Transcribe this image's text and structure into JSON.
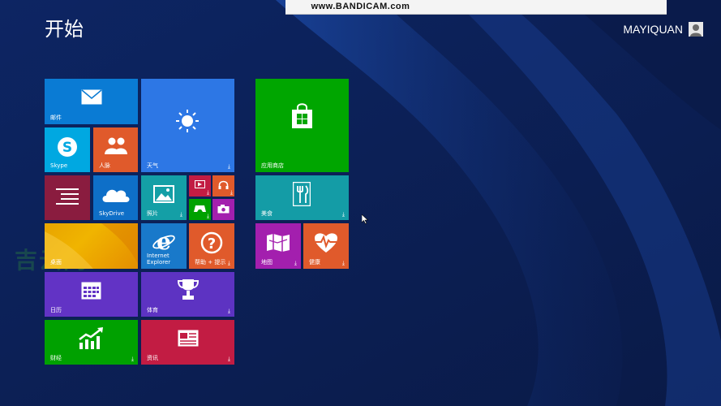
{
  "watermark": "www.BANDICAM.com",
  "start": {
    "title": "开始"
  },
  "user": {
    "name": "MAYIQUAN",
    "icon": "user-avatar-icon"
  },
  "side_logo": "吉云网",
  "colors": {
    "background": "#0b1d4f",
    "mail": "#0a7bd4",
    "weather": "#2d77e5",
    "store": "#00a600",
    "skype": "#00a8e1",
    "people": "#e05a2b",
    "reading": "#8a1c3f",
    "skydrive": "#0e6fc8",
    "photos": "#149fa6",
    "food": "#149ca6",
    "maps": "#a31fae",
    "health": "#e05a2b",
    "desktop": "#e8a400",
    "ie": "#1979ca",
    "help": "#e05a2b",
    "calendar": "#6233c5",
    "sports": "#5d33c2",
    "finance": "#00a100",
    "news": "#c21c43"
  },
  "tiles": {
    "mail": {
      "label": "邮件",
      "icon": "mail-icon"
    },
    "weather": {
      "label": "天气",
      "icon": "sun-icon"
    },
    "store": {
      "label": "应用商店",
      "icon": "store-bag-icon"
    },
    "skype": {
      "label": "Skype",
      "icon": "skype-icon"
    },
    "people": {
      "label": "人脉",
      "icon": "people-icon"
    },
    "reading": {
      "label": "",
      "icon": "reading-list-icon"
    },
    "skydrive": {
      "label": "SkyDrive",
      "icon": "cloud-icon"
    },
    "photos": {
      "label": "照片",
      "icon": "photo-icon"
    },
    "video": {
      "label": "",
      "icon": "video-icon"
    },
    "music": {
      "label": "",
      "icon": "headphones-icon"
    },
    "games": {
      "label": "",
      "icon": "game-controller-icon"
    },
    "camera": {
      "label": "",
      "icon": "camera-icon"
    },
    "food": {
      "label": "美食",
      "icon": "fork-knife-icon"
    },
    "desktop": {
      "label": "桌面",
      "icon": ""
    },
    "ie": {
      "label": "Internet\nExplorer",
      "icon": "internet-explorer-icon"
    },
    "help": {
      "label": "帮助 + 提示",
      "icon": "question-icon"
    },
    "maps": {
      "label": "地图",
      "icon": "map-icon"
    },
    "health": {
      "label": "健康",
      "icon": "heartbeat-icon"
    },
    "calendar": {
      "label": "日历",
      "icon": "calendar-icon"
    },
    "sports": {
      "label": "体育",
      "icon": "trophy-icon"
    },
    "finance": {
      "label": "财经",
      "icon": "chart-up-icon"
    },
    "news": {
      "label": "资讯",
      "icon": "newspaper-icon"
    }
  },
  "download_glyph": "⤓"
}
